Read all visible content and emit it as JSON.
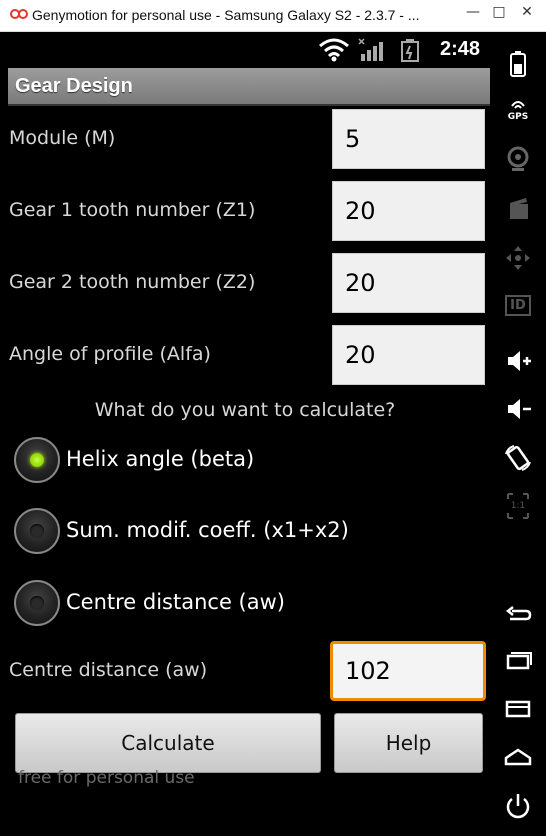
{
  "window": {
    "title": "Genymotion for personal use - Samsung Galaxy S2 - 2.3.7 - ...",
    "minimize_glyph": "—",
    "maximize_glyph": "□",
    "close_glyph": "✕"
  },
  "status": {
    "time": "2:48"
  },
  "app": {
    "title": "Gear Design"
  },
  "form": {
    "module_label": "Module (M)",
    "module_value": "5",
    "z1_label": "Gear 1 tooth number (Z1)",
    "z1_value": "20",
    "z2_label": "Gear 2 tooth number (Z2)",
    "z2_value": "20",
    "alfa_label": "Angle of profile (Alfa)",
    "alfa_value": "20",
    "question": "What do you want to calculate?",
    "options": [
      {
        "label": "Helix angle (beta)",
        "checked": true
      },
      {
        "label": "Sum. modif. coeff. (x1+x2)",
        "checked": false
      },
      {
        "label": "Centre distance (aw)",
        "checked": false
      }
    ],
    "aw_label": "Centre distance (aw)",
    "aw_value": "102"
  },
  "buttons": {
    "calculate": "Calculate",
    "help": "Help"
  },
  "footer": "free for personal use",
  "sidebar": {
    "gps_label": "GPS",
    "id_label": "ID",
    "scale_label": "1:1"
  },
  "colors": {
    "accent_focus": "#f08a00",
    "radio_checked": "#8ed400"
  }
}
